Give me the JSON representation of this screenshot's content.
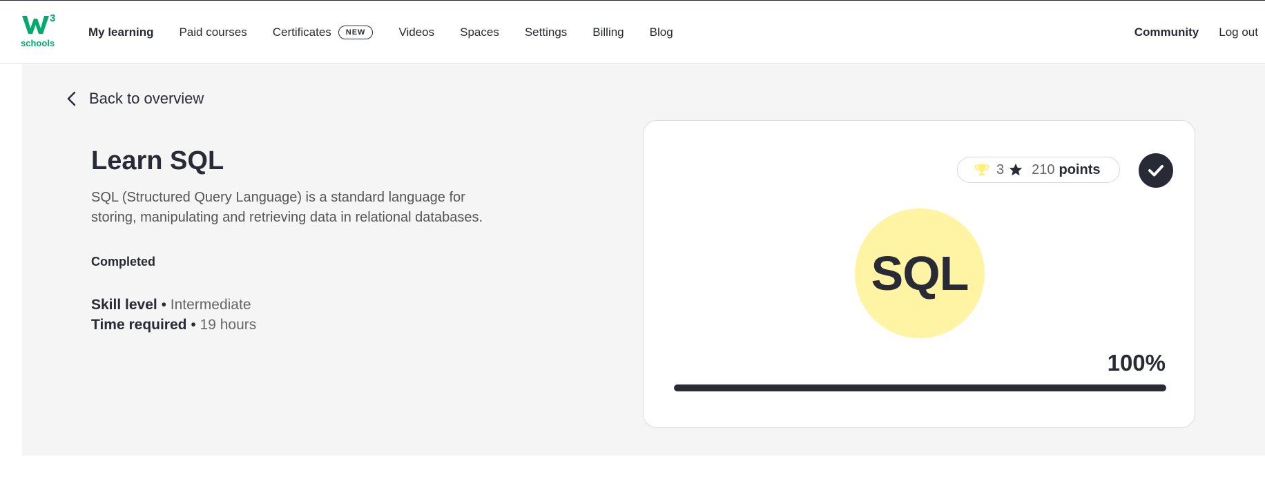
{
  "brand": {
    "logo_top": "W3",
    "logo_sup": "3",
    "logo_bottom": "schools",
    "color": "#04aa6d"
  },
  "nav": {
    "left": [
      {
        "label": "My learning",
        "active": true
      },
      {
        "label": "Paid courses"
      },
      {
        "label": "Certificates",
        "badge": "NEW"
      },
      {
        "label": "Videos"
      },
      {
        "label": "Spaces"
      },
      {
        "label": "Settings"
      },
      {
        "label": "Billing"
      },
      {
        "label": "Blog"
      }
    ],
    "right": [
      {
        "label": "Community"
      },
      {
        "label": "Log out"
      }
    ]
  },
  "back_label": "Back to overview",
  "course": {
    "title": "Learn SQL",
    "description": "SQL (Structured Query Language) is a standard language for storing, manipulating and retrieving data in relational databases.",
    "status": "Completed",
    "skill_label": "Skill level",
    "skill_value": "Intermediate",
    "time_label": "Time required",
    "time_value": "19 hours",
    "bullet": " • "
  },
  "card": {
    "trophies": "3",
    "points": "210",
    "points_label": "points",
    "logo_text": "SQL",
    "logo_bg": "#fff4a3",
    "progress_label": "100%",
    "progress": 1.0
  },
  "icons": {
    "back": "chevron-left-icon",
    "trophy": "trophy-icon",
    "star": "star-icon",
    "check": "check-circle-icon"
  }
}
